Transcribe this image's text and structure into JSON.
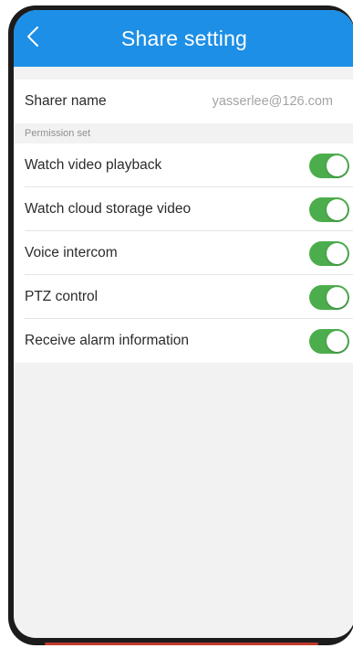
{
  "header": {
    "title": "Share setting",
    "back_icon": "chevron-left-icon",
    "color": "#1d8fe7"
  },
  "sharer": {
    "label": "Sharer name",
    "value": "yasserlee@126.com"
  },
  "permissions": {
    "section_label": "Permission set",
    "toggle_color": "#4cad4c",
    "items": [
      {
        "label": "Watch video playback",
        "enabled": true
      },
      {
        "label": "Watch cloud storage video",
        "enabled": true
      },
      {
        "label": "Voice intercom",
        "enabled": true
      },
      {
        "label": "PTZ control",
        "enabled": true
      },
      {
        "label": "Receive alarm information",
        "enabled": true
      }
    ]
  }
}
